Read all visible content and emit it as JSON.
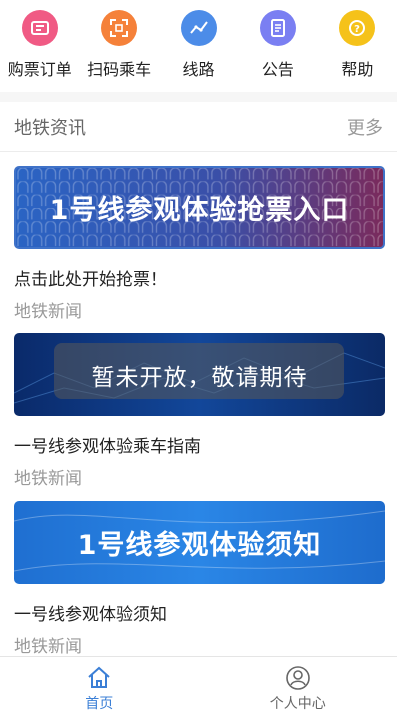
{
  "quick_nav": [
    {
      "label": "购票订单",
      "icon": "ticket-order-icon",
      "color": "#f05a84"
    },
    {
      "label": "扫码乘车",
      "icon": "qr-scan-icon",
      "color": "#f5813a"
    },
    {
      "label": "线路",
      "icon": "route-icon",
      "color": "#4c8ce8"
    },
    {
      "label": "公告",
      "icon": "announcement-icon",
      "color": "#7a7ff2"
    },
    {
      "label": "帮助",
      "icon": "help-icon",
      "color": "#f5c21a"
    }
  ],
  "section": {
    "title": "地铁资讯",
    "more": "更多"
  },
  "news": [
    {
      "banner_text": "1号线参观体验抢票入口",
      "title": "点击此处开始抢票！",
      "category": "地铁新闻"
    },
    {
      "banner_text": "暂未开放，敬请期待",
      "title": "一号线参观体验乘车指南",
      "category": "地铁新闻"
    },
    {
      "banner_text": "1号线参观体验须知",
      "title": "一号线参观体验须知",
      "category": "地铁新闻"
    }
  ],
  "tabs": [
    {
      "label": "首页",
      "icon": "home-icon",
      "active": true
    },
    {
      "label": "个人中心",
      "icon": "user-icon",
      "active": false
    }
  ],
  "colors": {
    "accent": "#3b7fd6",
    "inactive": "#666666"
  }
}
